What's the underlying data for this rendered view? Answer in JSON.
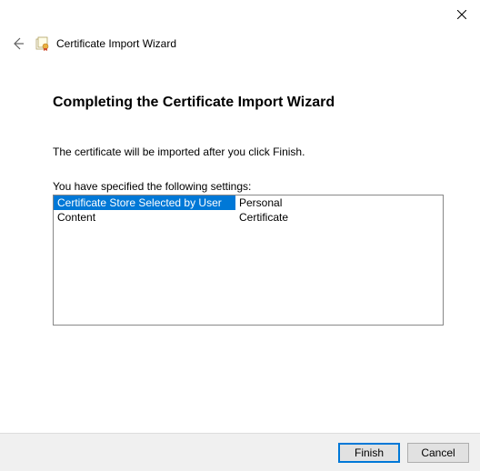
{
  "window": {
    "title": "Certificate Import Wizard"
  },
  "content": {
    "heading": "Completing the Certificate Import Wizard",
    "description": "The certificate will be imported after you click Finish.",
    "settings_label": "You have specified the following settings:",
    "settings": [
      {
        "key": "Certificate Store Selected by User",
        "value": "Personal",
        "selected": true
      },
      {
        "key": "Content",
        "value": "Certificate",
        "selected": false
      }
    ]
  },
  "footer": {
    "finish": "Finish",
    "cancel": "Cancel"
  }
}
